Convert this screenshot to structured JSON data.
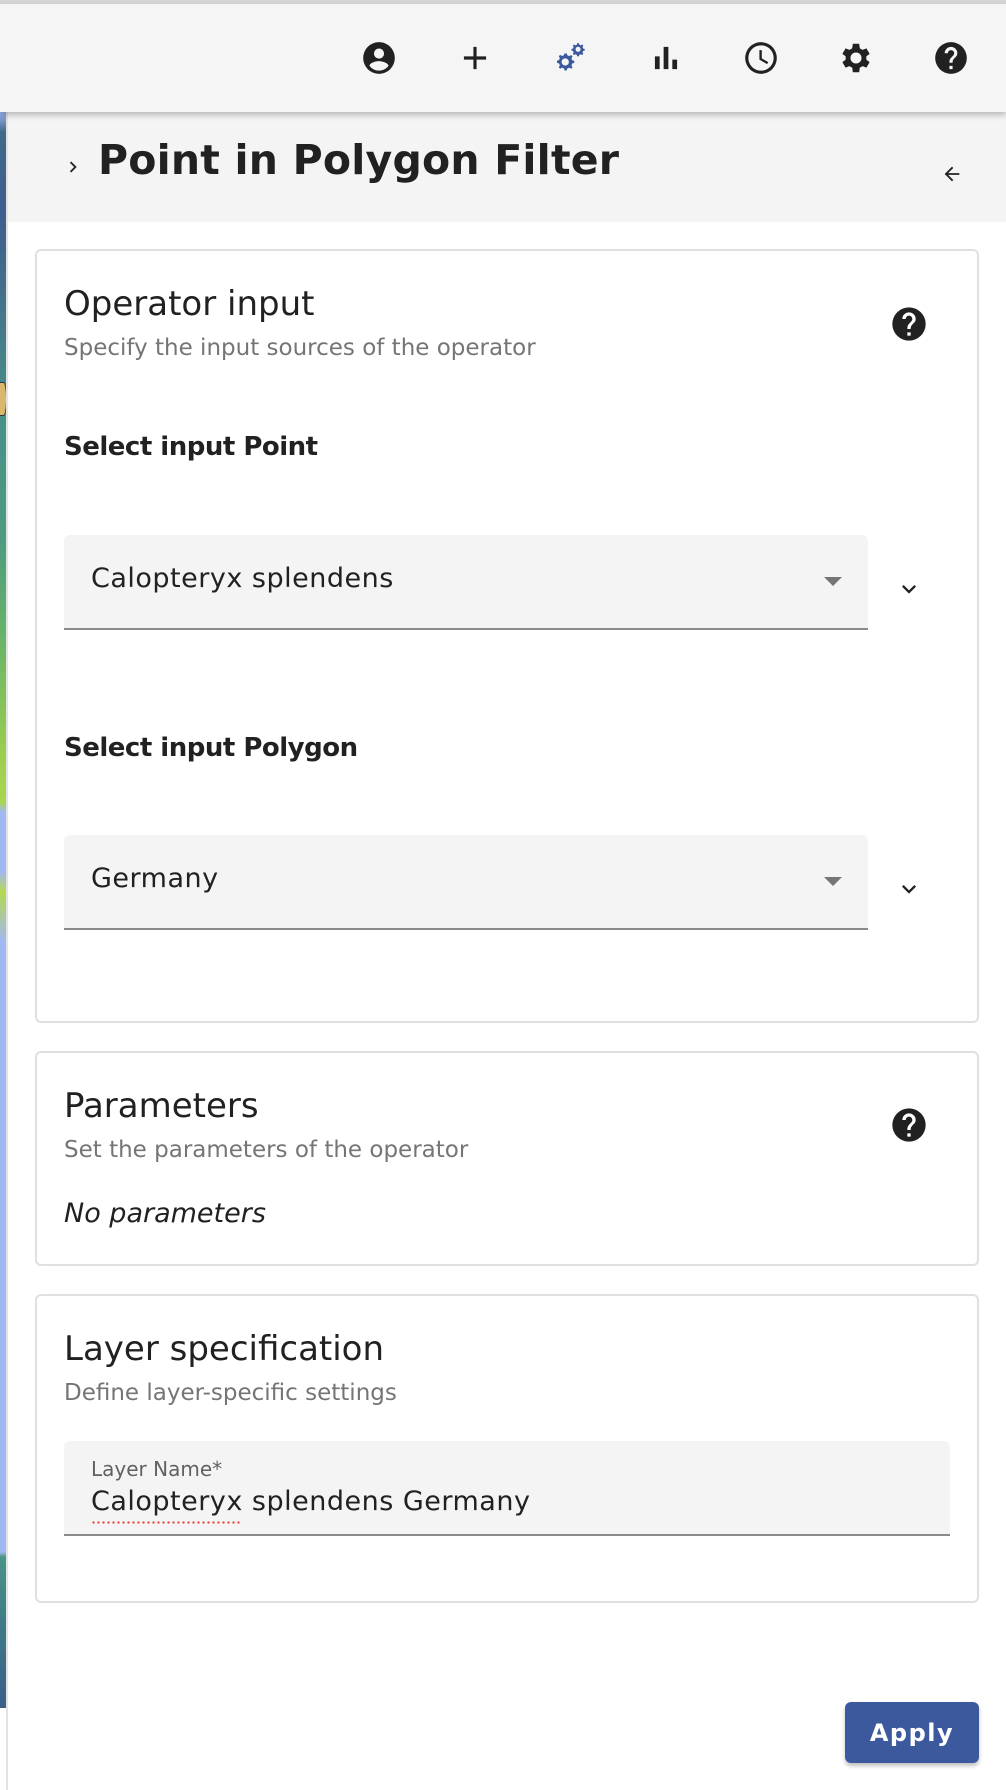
{
  "toolbar": {
    "buttons": [
      {
        "icon": "account-circle-icon",
        "label": "User account"
      },
      {
        "icon": "add-icon",
        "label": "Add data"
      },
      {
        "icon": "operators-gears-icon",
        "label": "Operators",
        "active": true
      },
      {
        "icon": "plots-bar-chart-icon",
        "label": "Plots"
      },
      {
        "icon": "time-clock-icon",
        "label": "Time"
      },
      {
        "icon": "settings-gear-icon",
        "label": "Settings"
      },
      {
        "icon": "help-icon",
        "label": "Help"
      }
    ],
    "active_color": "#3c599d",
    "icon_color": "#212121"
  },
  "panel": {
    "title": "Point in Polygon Filter"
  },
  "operator_input": {
    "title": "Operator input",
    "subtitle": "Specify the input sources of the operator",
    "point": {
      "label": "Select input Point",
      "value": "Calopteryx splendens"
    },
    "polygon": {
      "label": "Select input Polygon",
      "value": "Germany"
    }
  },
  "parameters": {
    "title": "Parameters",
    "subtitle": "Set the parameters of the operator",
    "empty_text": "No parameters"
  },
  "layer_spec": {
    "title": "Layer specification",
    "subtitle": "Define layer-specific settings",
    "layer_name_label": "Layer Name*",
    "layer_name_value": "Calopteryx splendens Germany"
  },
  "actions": {
    "apply_label": "Apply",
    "apply_color": "#3c599d"
  }
}
